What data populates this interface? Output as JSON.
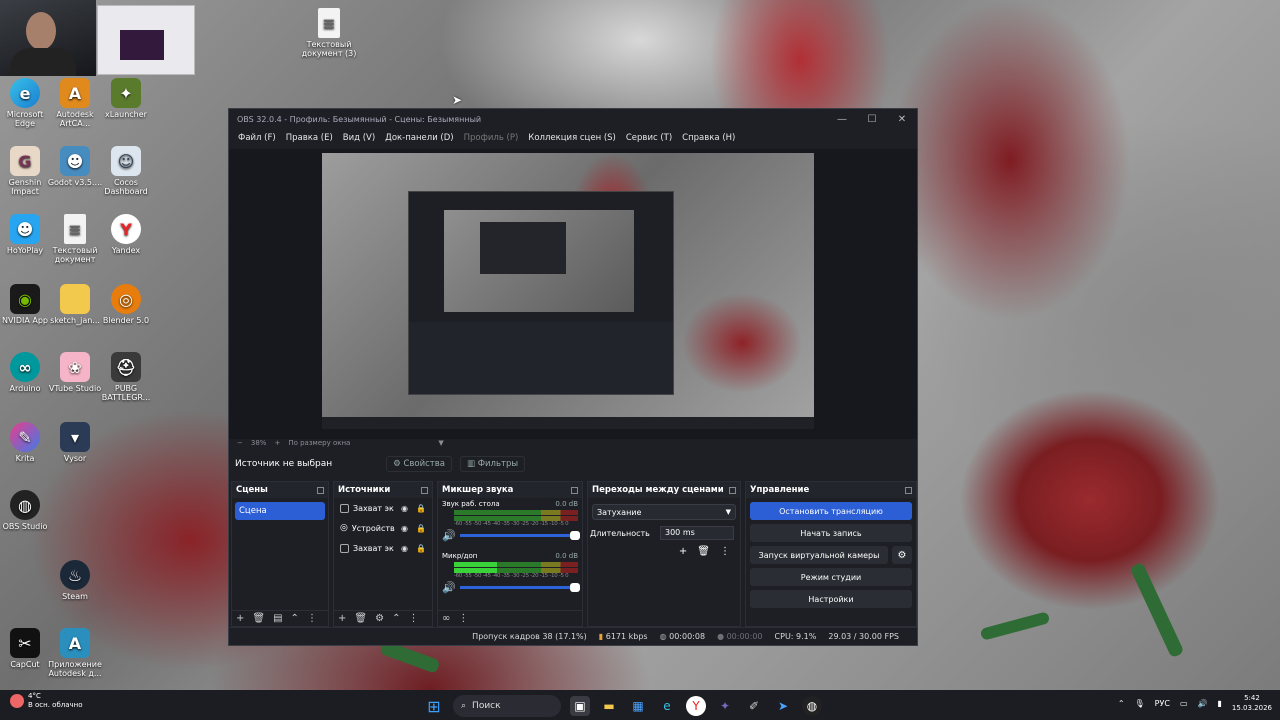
{
  "desktop": {
    "icons": [
      {
        "label": "Текстовый документ (3)",
        "icon": "document-icon"
      },
      {
        "label": "Microsoft Edge",
        "icon": "edge-icon"
      },
      {
        "label": "Autodesk ArtCA...",
        "icon": "autodesk-artcam-icon"
      },
      {
        "label": "xLauncher",
        "icon": "xlauncher-icon"
      },
      {
        "label": "Genshin Impact",
        "icon": "genshin-icon"
      },
      {
        "label": "Godot v3.5....",
        "icon": "godot-icon"
      },
      {
        "label": "Cocos Dashboard",
        "icon": "cocos-icon"
      },
      {
        "label": "HoYoPlay",
        "icon": "hoyoplay-icon"
      },
      {
        "label": "Текстовый документ",
        "icon": "document-icon"
      },
      {
        "label": "Yandex",
        "icon": "yandex-icon"
      },
      {
        "label": "NVIDIA App",
        "icon": "nvidia-icon"
      },
      {
        "label": "sketch_jan...",
        "icon": "folder-icon"
      },
      {
        "label": "Blender 5.0",
        "icon": "blender-icon"
      },
      {
        "label": "Arduino",
        "icon": "arduino-icon"
      },
      {
        "label": "VTube Studio",
        "icon": "vtube-icon"
      },
      {
        "label": "PUBG BATTLEGR...",
        "icon": "pubg-icon"
      },
      {
        "label": "Krita",
        "icon": "krita-icon"
      },
      {
        "label": "Vysor",
        "icon": "vysor-icon"
      },
      {
        "label": "OBS Studio",
        "icon": "obs-icon"
      },
      {
        "label": "Steam",
        "icon": "steam-icon"
      },
      {
        "label": "CapCut",
        "icon": "capcut-icon"
      },
      {
        "label": "Приложение Autodesk д...",
        "icon": "autodesk-app-icon"
      }
    ]
  },
  "obs": {
    "title": "OBS 32.0.4 - Профиль: Безымянный - Сцены: Безымянный",
    "menu": [
      "Файл (F)",
      "Правка (E)",
      "Вид (V)",
      "Док-панели (D)",
      "Профиль (P)",
      "Коллекция сцен (S)",
      "Сервис (T)",
      "Справка (H)"
    ],
    "zoom": "38%",
    "zoom_mode": "По размеру окна",
    "source_status": "Источник не выбран",
    "properties_label": "Свойства",
    "filters_label": "Фильтры",
    "scenes": {
      "title": "Сцены",
      "items": [
        "Сцена"
      ]
    },
    "sources": {
      "title": "Источники",
      "items": [
        "Захват эк",
        "Устройств",
        "Захват эк"
      ]
    },
    "mixer": {
      "title": "Микшер звука",
      "channels": [
        {
          "name": "Звук раб. стола",
          "db": "0.0 dB",
          "level": 0
        },
        {
          "name": "Микр/доп",
          "db": "0.0 dB",
          "level": 0.35
        }
      ],
      "scale": "-60 -55 -50 -45 -40 -35 -30 -25 -20 -15 -10 -5 0"
    },
    "transitions": {
      "title": "Переходы между сценами",
      "selected": "Затухание",
      "duration_label": "Длительность",
      "duration": "300 ms"
    },
    "controls": {
      "title": "Управление",
      "stop_stream": "Остановить трансляцию",
      "start_record": "Начать запись",
      "virtual_cam": "Запуск виртуальной камеры",
      "studio_mode": "Режим студии",
      "settings": "Настройки"
    },
    "status": {
      "dropped": "Пропуск кадров 38 (17.1%)",
      "bitrate": "6171 kbps",
      "stream_time": "00:00:08",
      "record_time": "00:00:00",
      "cpu": "CPU: 9.1%",
      "fps": "29.03 / 30.00 FPS"
    }
  },
  "taskbar": {
    "weather_temp": "4°C",
    "weather_desc": "В осн. облачно",
    "search_placeholder": "Поиск",
    "lang": "РУС",
    "time": "5:42",
    "date": "15.03.2026"
  },
  "colors": {
    "accent": "#2c5fd6",
    "obs_bg": "#1d1f25",
    "rose": "#8e2328"
  }
}
